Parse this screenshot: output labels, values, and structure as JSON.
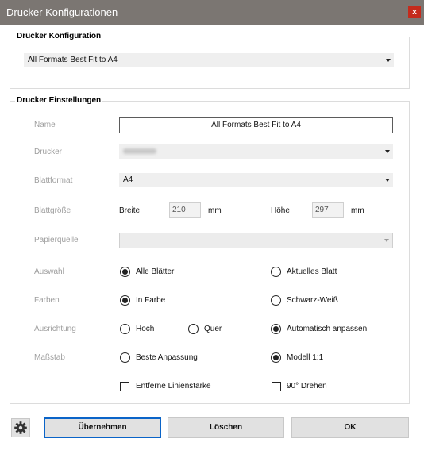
{
  "window": {
    "title": "Drucker Konfigurationen",
    "close_glyph": "x"
  },
  "konfiguration": {
    "legend": "Drucker Konfiguration",
    "selected": "All Formats Best Fit to A4"
  },
  "einstellungen": {
    "legend": "Drucker Einstellungen",
    "name_label": "Name",
    "name_value": "All Formats Best Fit to A4",
    "drucker_label": "Drucker",
    "drucker_value": "",
    "blattformat_label": "Blattformat",
    "blattformat_value": "A4",
    "blattgroesse_label": "Blattgröße",
    "breite_label": "Breite",
    "breite_value": "210",
    "breite_unit": "mm",
    "hoehe_label": "Höhe",
    "hoehe_value": "297",
    "hoehe_unit": "mm",
    "papierquelle_label": "Papierquelle",
    "papierquelle_value": "",
    "auswahl_label": "Auswahl",
    "auswahl_options": [
      "Alle Blätter",
      "Aktuelles Blatt"
    ],
    "auswahl_selected": 0,
    "farben_label": "Farben",
    "farben_options": [
      "In Farbe",
      "Schwarz-Weiß"
    ],
    "farben_selected": 0,
    "ausrichtung_label": "Ausrichtung",
    "ausrichtung_options": [
      "Hoch",
      "Quer",
      "Automatisch anpassen"
    ],
    "ausrichtung_selected": 2,
    "massstab_label": "Maßstab",
    "massstab_options": [
      "Beste Anpassung",
      "Modell 1:1"
    ],
    "massstab_selected": 1,
    "linienstaerke_label": "Entferne Linienstärke",
    "linienstaerke_checked": false,
    "drehen_label": "90° Drehen",
    "drehen_checked": false
  },
  "footer": {
    "settings_icon": "gear-icon",
    "uebernehmen_label": "Übernehmen",
    "loeschen_label": "Löschen",
    "ok_label": "OK"
  },
  "colors": {
    "titlebar": "#7b7672",
    "close_button": "#c42b1c",
    "primary_border": "#0a64c8"
  }
}
